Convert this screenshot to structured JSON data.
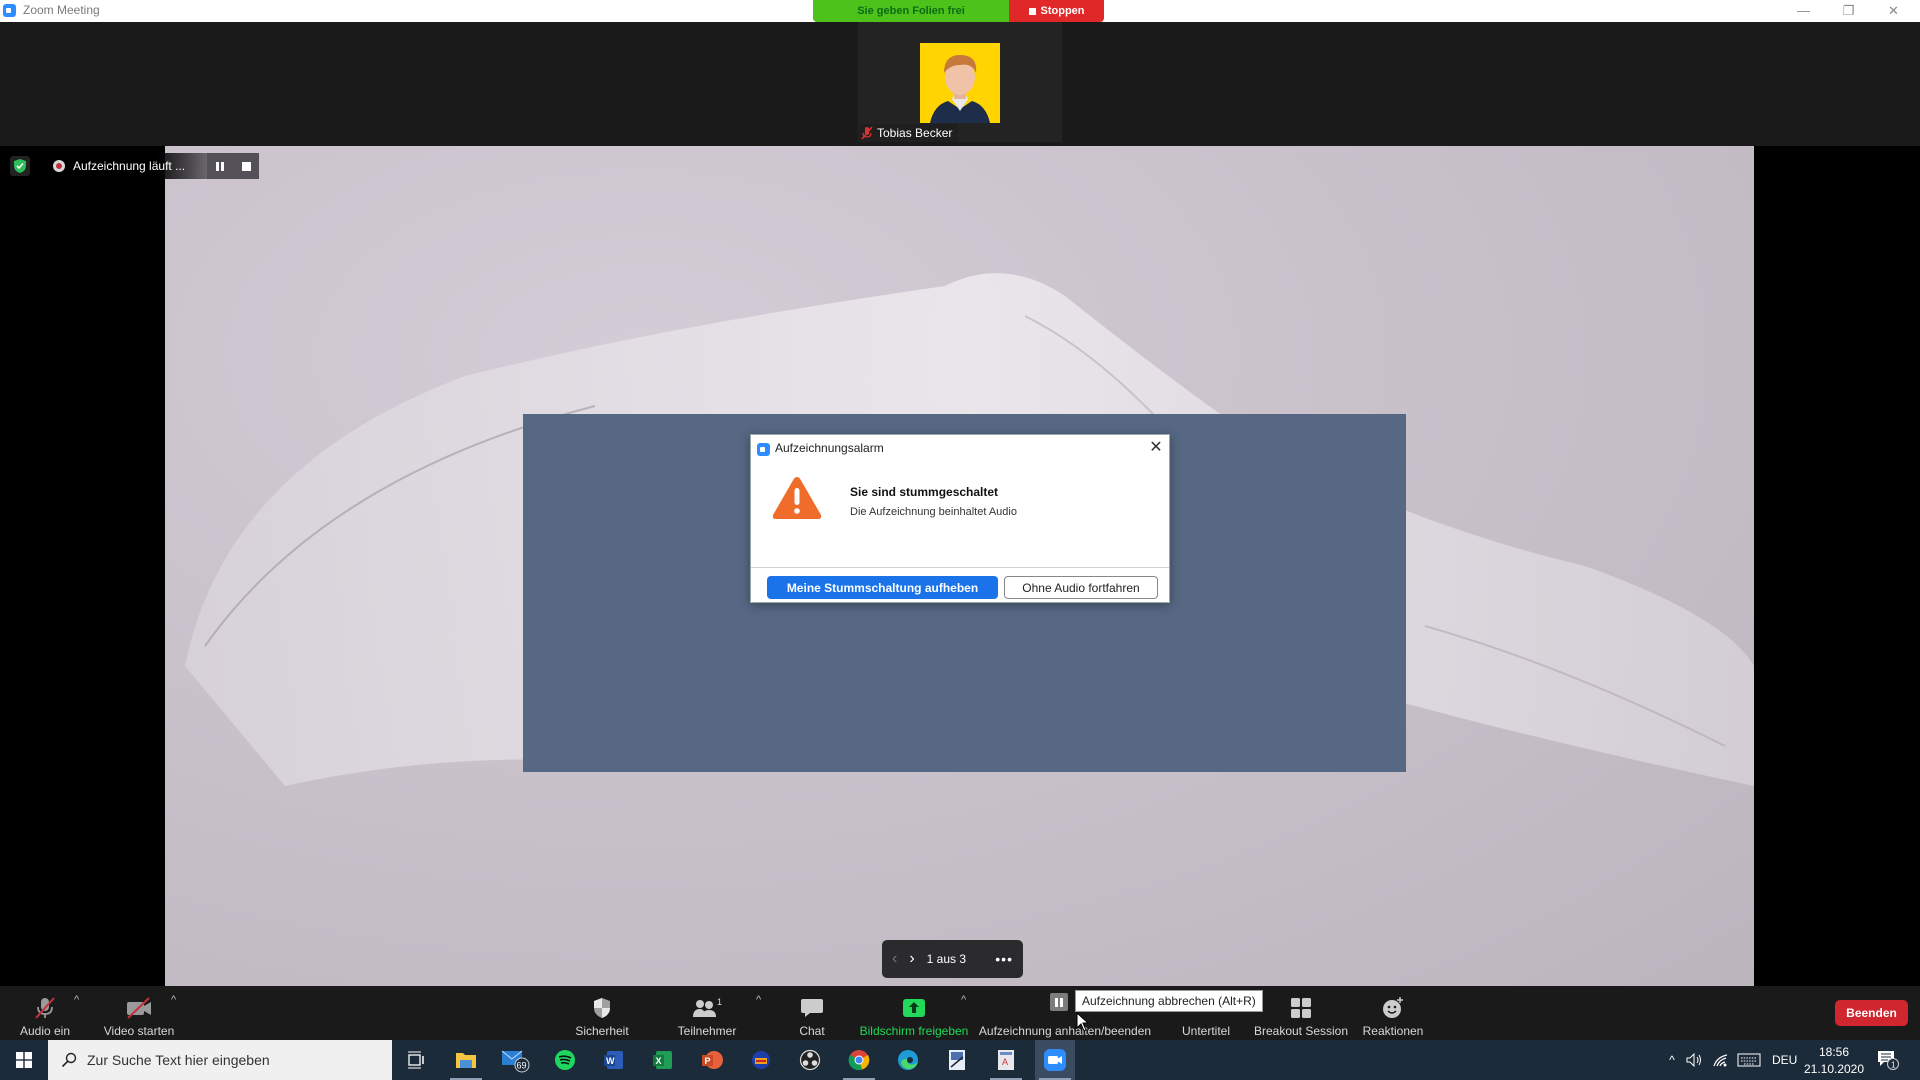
{
  "window": {
    "title": "Zoom Meeting",
    "controls": {
      "minimize": "—",
      "maximize": "❐",
      "close": "✕"
    }
  },
  "share_banner": {
    "status": "Sie geben Folien frei",
    "stop_label": "Stoppen",
    "status_color": "#4cc21b",
    "stop_color": "#e02828"
  },
  "participant_thumb": {
    "name": "Tobias Becker",
    "muted": true,
    "avatar_bg": "#ffd400"
  },
  "recording": {
    "status": "Aufzeichnung läuft ...",
    "pause_icon": "pause-icon",
    "stop_icon": "stop-icon"
  },
  "dialog": {
    "title": "Aufzeichnungsalarm",
    "heading": "Sie sind stummgeschaltet",
    "message": "Die Aufzeichnung beinhaltet Audio",
    "primary_button": "Meine Stummschaltung aufheben",
    "secondary_button": "Ohne Audio fortfahren",
    "close": "✕",
    "warning_color": "#ef6c2b",
    "primary_color": "#1a73e8"
  },
  "slide_nav": {
    "prev": "‹",
    "next": "›",
    "page_text": "1 aus 3",
    "more": "•••",
    "current_page": 1,
    "total_pages": 3
  },
  "toolbar": {
    "audio": "Audio ein",
    "video": "Video starten",
    "security": "Sicherheit",
    "participants": "Teilnehmer",
    "participants_count": "1",
    "chat": "Chat",
    "share": "Bildschirm freigeben",
    "record": "Aufzeichnung anhalten/beenden",
    "record_tooltip": "Aufzeichnung abbrechen (Alt+R)",
    "captions": "Untertitel",
    "breakout": "Breakout Session",
    "reactions": "Reaktionen",
    "end": "Beenden",
    "caret": "^",
    "share_color": "#23d959",
    "end_color": "#d0262f"
  },
  "taskbar": {
    "search_placeholder": "Zur Suche Text hier eingeben",
    "apps": [
      {
        "name": "task-view"
      },
      {
        "name": "file-explorer"
      },
      {
        "name": "mail",
        "badge": "69"
      },
      {
        "name": "spotify"
      },
      {
        "name": "word"
      },
      {
        "name": "excel"
      },
      {
        "name": "powerpoint"
      },
      {
        "name": "audacity"
      },
      {
        "name": "obs"
      },
      {
        "name": "chrome"
      },
      {
        "name": "edge"
      },
      {
        "name": "app-generic-1"
      },
      {
        "name": "app-generic-2"
      },
      {
        "name": "zoom"
      }
    ],
    "tray": {
      "chevron": "^",
      "language": "DEU",
      "time": "18:56",
      "date": "21.10.2020",
      "notifications": "1"
    }
  }
}
